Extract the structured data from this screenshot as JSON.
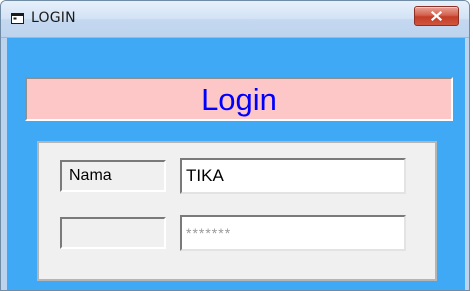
{
  "window": {
    "title": "LOGIN",
    "close_icon": "close-icon",
    "app_icon": "window-icon"
  },
  "banner": {
    "title": "Login"
  },
  "form": {
    "name_label": "Nama",
    "name_value": "TIKA",
    "password_label": "",
    "password_value": "*******"
  },
  "colors": {
    "client_background": "#3fa9f5",
    "banner_background": "#fec7c7",
    "banner_text": "#0000ff",
    "panel_background": "#f0f0f0"
  }
}
